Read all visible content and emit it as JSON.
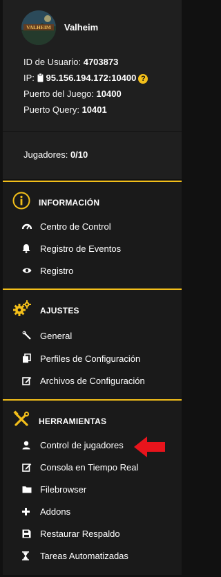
{
  "server": {
    "name": "Valheim",
    "avatar_text": "VALHEIM",
    "user_id_label": "ID de Usuario:",
    "user_id": "4703873",
    "ip_label": "IP:",
    "ip": "95.156.194.172:10400",
    "game_port_label": "Puerto del Juego:",
    "game_port": "10400",
    "query_port_label": "Puerto Query:",
    "query_port": "10401",
    "help_symbol": "?"
  },
  "players": {
    "label": "Jugadores:",
    "value": "0/10"
  },
  "sections": {
    "info": {
      "title": "INFORMACIÓN",
      "icon": "info-circle-icon",
      "items": [
        {
          "label": "Centro de Control",
          "icon": "gauge-icon"
        },
        {
          "label": "Registro de Eventos",
          "icon": "bell-icon"
        },
        {
          "label": "Registro",
          "icon": "eye-icon"
        }
      ]
    },
    "settings": {
      "title": "AJUSTES",
      "icon": "gears-icon",
      "items": [
        {
          "label": "General",
          "icon": "wrench-icon"
        },
        {
          "label": "Perfiles de Configuración",
          "icon": "copy-icon"
        },
        {
          "label": "Archivos de Configuración",
          "icon": "edit-icon"
        }
      ]
    },
    "tools": {
      "title": "HERRAMIENTAS",
      "icon": "tools-icon",
      "items": [
        {
          "label": "Control de jugadores",
          "icon": "user-icon"
        },
        {
          "label": "Consola en Tiempo Real",
          "icon": "edit-icon"
        },
        {
          "label": "Filebrowser",
          "icon": "folder-icon"
        },
        {
          "label": "Addons",
          "icon": "plus-icon"
        },
        {
          "label": "Restaurar Respaldo",
          "icon": "save-icon"
        },
        {
          "label": "Tareas Automatizadas",
          "icon": "hourglass-icon"
        }
      ]
    }
  },
  "colors": {
    "accent": "#f3bf1a",
    "arrow": "#e8141c",
    "panel": "#1f1f1f",
    "background": "#111111"
  }
}
